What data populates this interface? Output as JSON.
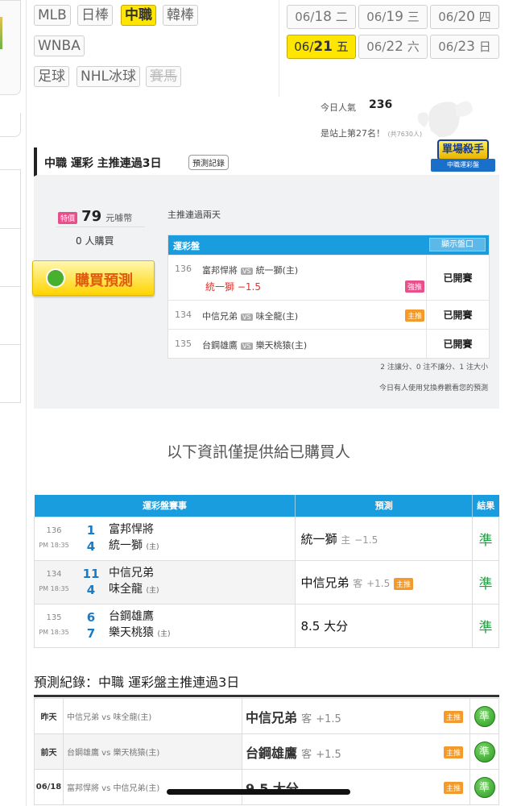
{
  "leagues": {
    "row1": [
      "MLB",
      "日棒",
      "中職",
      "韓棒"
    ],
    "row2": [
      "WNBA"
    ],
    "row3": [
      "足球",
      "NHL冰球",
      "賽馬"
    ],
    "active": "中職",
    "disabled": "賽馬"
  },
  "dates": [
    {
      "md": "06/",
      "day": "18",
      "wd": "二"
    },
    {
      "md": "06/",
      "day": "19",
      "wd": "三"
    },
    {
      "md": "06/",
      "day": "20",
      "wd": "四"
    },
    {
      "md": "06/",
      "day": "21",
      "wd": "五"
    },
    {
      "md": "06/",
      "day": "22",
      "wd": "六"
    },
    {
      "md": "06/",
      "day": "23",
      "wd": "日"
    }
  ],
  "popularity": {
    "label": "今日人氣",
    "value": "236",
    "rank_text": "是站上第27名！",
    "rank_small": "(共7630人)"
  },
  "expert": {
    "title": "中職 運彩 主推連過3日",
    "record_button": "預測記錄",
    "ribbon_main": "單場殺手",
    "ribbon_sub": "中職運彩盤",
    "price_tag": "特價",
    "price": "79",
    "price_unit": "元噱幣",
    "buyers": "0 人購買",
    "streak_text": "主推連過兩天",
    "buy_button": "購買預測",
    "table_title": "運彩盤",
    "show_odds": "顯示盤口",
    "games": [
      {
        "id": "136",
        "away": "富邦悍將",
        "home": "統一獅(主)",
        "pick": "統一獅 −1.5",
        "tag": "強推",
        "status": "已開賽"
      },
      {
        "id": "134",
        "away": "中信兄弟",
        "home": "味全龍(主)",
        "pick": "",
        "tag": "主推",
        "status": "已開賽"
      },
      {
        "id": "135",
        "away": "台鋼雄鷹",
        "home": "樂天桃猿(主)",
        "pick": "",
        "tag": "",
        "status": "已開賽"
      }
    ],
    "summary1": "2 注讓分、0 注不讓分、1 注大小",
    "summary2": "今日有人使用兌換券觀看您的預測"
  },
  "notice": "以下資訊僅提供給已購買人",
  "results": {
    "headers": [
      "運彩盤賽事",
      "預測",
      "結果"
    ],
    "rows": [
      {
        "id": "136",
        "time": "PM 18:35",
        "away_score": "1",
        "away": "富邦悍將",
        "home_score": "4",
        "home": "統一獅",
        "home_tag": "(主)",
        "pick_team": "統一獅",
        "pick_side": "主",
        "pick_line": "−1.5",
        "pick_tag": "",
        "result": "準"
      },
      {
        "id": "134",
        "time": "PM 18:35",
        "away_score": "11",
        "away": "中信兄弟",
        "home_score": "4",
        "home": "味全龍",
        "home_tag": "(主)",
        "pick_team": "中信兄弟",
        "pick_side": "客",
        "pick_line": "+1.5",
        "pick_tag": "主推",
        "result": "準"
      },
      {
        "id": "135",
        "time": "PM 18:35",
        "away_score": "6",
        "away": "台鋼雄鷹",
        "home_score": "7",
        "home": "樂天桃猿",
        "home_tag": "(主)",
        "pick_team": "8.5 大分",
        "pick_side": "",
        "pick_line": "",
        "pick_tag": "",
        "result": "準"
      }
    ]
  },
  "history": {
    "title": "預測紀錄：中職 運彩盤主推連過3日",
    "rows": [
      {
        "date": "昨天",
        "match": "中信兄弟 vs 味全龍(主)",
        "pick_team": "中信兄弟",
        "pick_side": "客",
        "pick_line": "+1.5",
        "tag": "主推",
        "result": "準"
      },
      {
        "date": "前天",
        "match": "台鋼雄鷹 vs 樂天桃猿(主)",
        "pick_team": "台鋼雄鷹",
        "pick_side": "客",
        "pick_line": "+1.5",
        "tag": "主推",
        "result": "準"
      },
      {
        "date": "06/18",
        "match": "富邦悍將 vs 中信兄弟(主)",
        "pick_team": "9.5 大分",
        "pick_side": "",
        "pick_line": "",
        "tag": "主推",
        "result": "準"
      }
    ]
  },
  "colors": {
    "accent": "#1a9ddf",
    "active": "#ffe600",
    "correct": "#19a53c",
    "pick_red": "#e0332d",
    "tag_orange": "#f29b2c"
  }
}
